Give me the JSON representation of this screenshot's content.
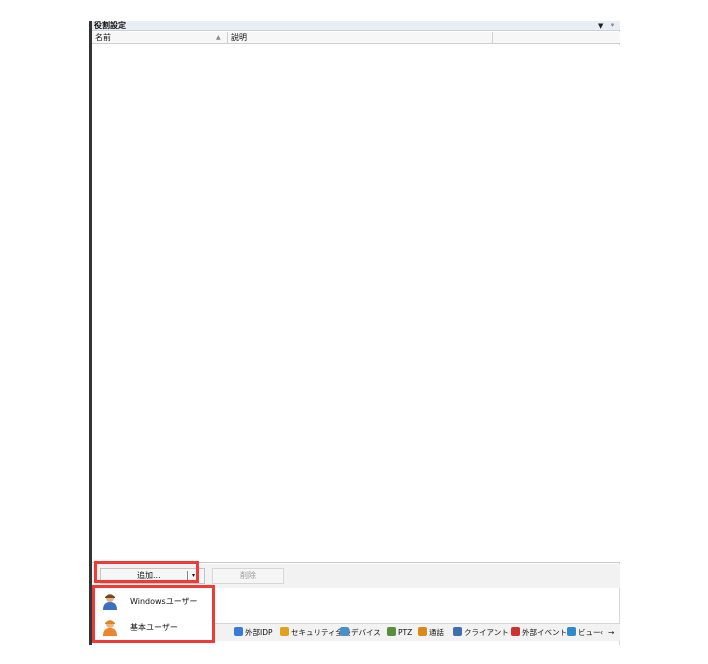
{
  "panel": {
    "title": "役割設定",
    "title_icons": [
      "▼",
      "ᵠ"
    ]
  },
  "list": {
    "columns": [
      "名前",
      "説明"
    ],
    "sort_indicator": "▲"
  },
  "buttons": {
    "add_label": "追加...",
    "add_arrow": "▾",
    "delete_label": "削除"
  },
  "dropdown": {
    "items": [
      {
        "label": "Windowsユーザー",
        "icon": "windows-user-icon"
      },
      {
        "label": "基本ユーザー",
        "icon": "basic-user-icon"
      }
    ]
  },
  "nav": {
    "items": [
      {
        "label": "外部IDP",
        "icon": "external-idp-icon",
        "color": "#3a7bd5"
      },
      {
        "label": "セキュリティ全般",
        "icon": "lock-icon",
        "color": "#e0a21b"
      },
      {
        "label": "デバイス",
        "icon": "device-icon",
        "color": "#4a90c8"
      },
      {
        "label": "PTZ",
        "icon": "ptz-icon",
        "color": "#5a8f3a"
      },
      {
        "label": "通話",
        "icon": "speech-icon",
        "color": "#d98a1a"
      },
      {
        "label": "クライアント",
        "icon": "monitor-icon",
        "color": "#3f6fae"
      },
      {
        "label": "外部イベント",
        "icon": "event-icon",
        "color": "#cc3333"
      },
      {
        "label": "ビュー",
        "icon": "view-icon",
        "color": "#2f8ac9"
      }
    ],
    "scroll_left": "‹",
    "scroll_right": "→"
  }
}
